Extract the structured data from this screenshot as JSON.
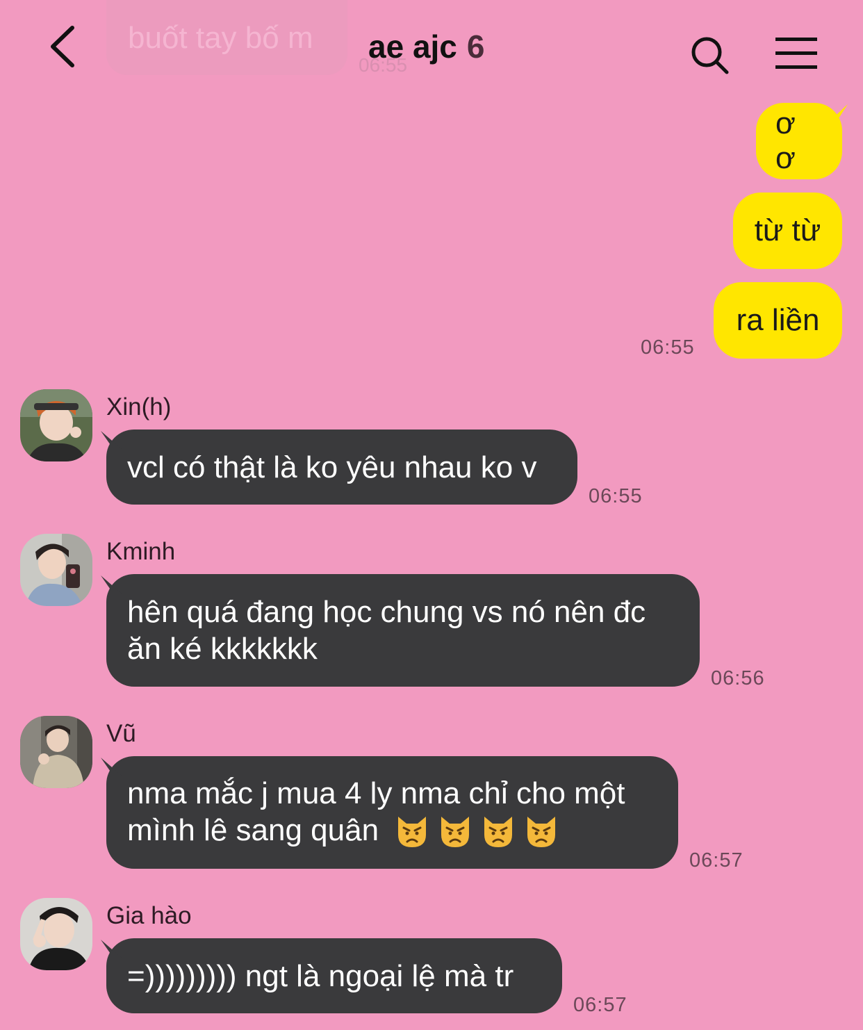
{
  "header": {
    "title": "ae ajc",
    "member_count": "6",
    "back_icon": "chevron-left-icon",
    "search_icon": "search-icon",
    "menu_icon": "hamburger-menu-icon"
  },
  "faded_message": {
    "text": "buốt tay bố m",
    "time": "06:55"
  },
  "outgoing": {
    "messages": [
      "ơ ơ",
      "từ từ",
      "ra liền"
    ],
    "time": "06:55",
    "bubble_color": "#ffe600"
  },
  "incoming": [
    {
      "sender": "Xin(h)",
      "lines": [
        "vcl có thật là ko yêu nhau ko v"
      ],
      "time": "06:55"
    },
    {
      "sender": "Kminh",
      "lines": [
        "hên quá đang học chung vs nó nên đc",
        "ăn ké kkkkkkk"
      ],
      "time": "06:56"
    },
    {
      "sender": "Vũ",
      "lines": [
        "nma mắc j mua 4 ly nma chỉ cho một",
        "mình lê sang quân"
      ],
      "emoji": [
        "pouting-cat-emoji",
        "pouting-cat-emoji",
        "pouting-cat-emoji",
        "pouting-cat-emoji"
      ],
      "time": "06:57"
    },
    {
      "sender": "Gia hào",
      "lines": [
        "=))))))))) ngt là ngoại lệ mà tr"
      ],
      "time": "06:57"
    }
  ],
  "colors": {
    "background": "#f29ac0",
    "incoming_bubble": "#3a3a3c",
    "outgoing_bubble": "#ffe600"
  }
}
